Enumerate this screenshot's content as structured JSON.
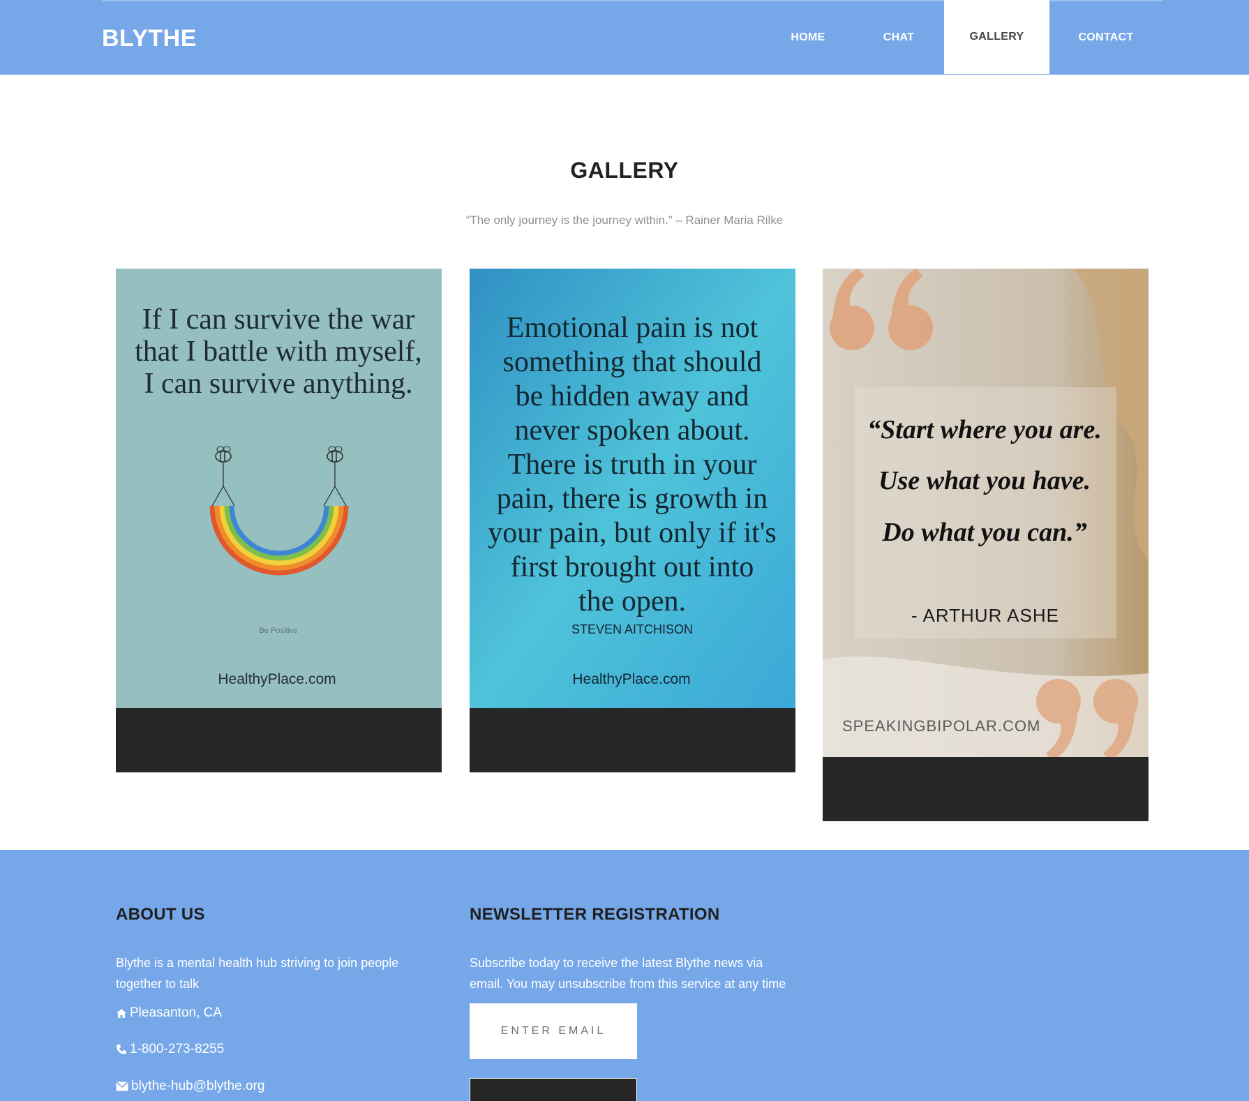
{
  "header": {
    "brand": "BLYTHE",
    "nav": [
      {
        "label": "HOME",
        "active": false
      },
      {
        "label": "CHAT",
        "active": false
      },
      {
        "label": "GALLERY",
        "active": true
      },
      {
        "label": "CONTACT",
        "active": false
      }
    ]
  },
  "gallery": {
    "title": "GALLERY",
    "quote": "“The only journey is the journey within.” – Rainer Maria Rilke",
    "cards": [
      {
        "lines": [
          "If I can survive the war",
          "that I battle with myself,",
          "I can survive anything."
        ],
        "caption": "Be Positive",
        "source": "HealthyPlace.com"
      },
      {
        "lines": [
          "Emotional pain is not",
          "something that should",
          "be hidden away and",
          "never spoken about.",
          "There is truth in your",
          "pain, there is growth in",
          "your pain, but only if it's",
          "first brought out into",
          "the open."
        ],
        "author": "STEVEN AITCHISON",
        "source": "HealthyPlace.com"
      },
      {
        "lines": [
          "“Start where you are.",
          "Use what you have.",
          "Do what you can.”"
        ],
        "author": "- ARTHUR ASHE",
        "source": "SPEAKINGBIPOLAR.COM"
      }
    ]
  },
  "footer": {
    "about_title": "ABOUT US",
    "about_text": "Blythe is a mental health hub striving to join people together to talk",
    "location": "Pleasanton, CA",
    "phone": "1-800-273-8255",
    "email": "blythe-hub@blythe.org",
    "newsletter_title": "NEWSLETTER REGISTRATION",
    "newsletter_text": "Subscribe today to receive the latest Blythe news via email. You may unsubscribe from this service at any time",
    "email_placeholder": "ENTER EMAIL"
  },
  "colors": {
    "header_bg": "#76a7e8",
    "card_dark": "#262626",
    "card1_bg": "#96bfc0",
    "card2_bg": "#3fb7d6",
    "card3_bg": "#cfc3b2",
    "quote_mark": "#e0a27a"
  }
}
